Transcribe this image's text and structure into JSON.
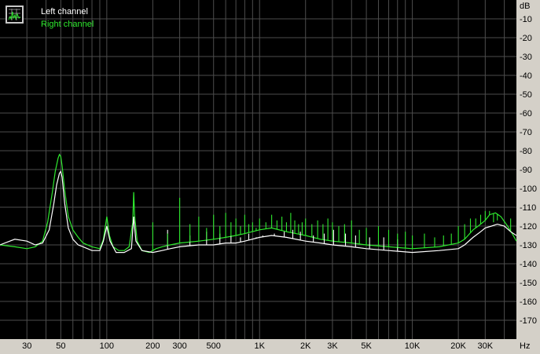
{
  "colors": {
    "plot_bg": "#000000",
    "grid": "#4d4d4d",
    "frame_bg": "#d4d0c8",
    "left_channel": "#ffffff",
    "right_channel": "#2ee82e"
  },
  "chart_data": {
    "type": "line",
    "x_scale": "log",
    "xlim": [
      20,
      48000
    ],
    "ylim": [
      -180,
      0
    ],
    "grid": true,
    "legend_position": "top-left",
    "legend_icon": "spectrum-icon",
    "y_unit": "dB",
    "x_unit": "Hz",
    "y_ticks": [
      "-10",
      "-20",
      "-30",
      "-40",
      "-50",
      "-60",
      "-70",
      "-80",
      "-90",
      "-100",
      "-110",
      "-120",
      "-130",
      "-140",
      "-150",
      "-160",
      "-170"
    ],
    "y_tick_values": [
      -10,
      -20,
      -30,
      -40,
      -50,
      -60,
      -70,
      -80,
      -90,
      -100,
      -110,
      -120,
      -130,
      -140,
      -150,
      -160,
      -170
    ],
    "x_ticks": [
      "30",
      "50",
      "100",
      "200",
      "300",
      "500",
      "1K",
      "2K",
      "3K",
      "5K",
      "10K",
      "20K",
      "30K"
    ],
    "x_tick_values": [
      30,
      50,
      100,
      200,
      300,
      500,
      1000,
      2000,
      3000,
      5000,
      10000,
      20000,
      30000
    ],
    "series": [
      {
        "name": "Left channel",
        "color": "#ffffff",
        "x": [
          20,
          25,
          30,
          34,
          38,
          42,
          45,
          47,
          49,
          50,
          51,
          53,
          56,
          60,
          65,
          70,
          80,
          90,
          95,
          100,
          105,
          115,
          130,
          145,
          150,
          155,
          170,
          200,
          230,
          260,
          300,
          400,
          500,
          600,
          700,
          800,
          1000,
          1200,
          1500,
          2000,
          2500,
          3000,
          4000,
          5000,
          7000,
          10000,
          15000,
          20000,
          22000,
          25000,
          28000,
          30000,
          33000,
          36000,
          40000,
          44000,
          48000
        ],
        "y": [
          -130,
          -127,
          -128,
          -130,
          -129,
          -122,
          -108,
          -98,
          -92,
          -91,
          -94,
          -108,
          -121,
          -127,
          -130,
          -131,
          -133,
          -133,
          -128,
          -120,
          -128,
          -134,
          -134,
          -132,
          -115,
          -128,
          -133,
          -134,
          -133,
          -132,
          -131,
          -130,
          -130,
          -129,
          -129,
          -128,
          -126,
          -125,
          -126,
          -128,
          -129,
          -130,
          -131,
          -132,
          -133,
          -134,
          -133,
          -132,
          -130,
          -126,
          -123,
          -121,
          -120,
          -119,
          -120,
          -123,
          -125
        ]
      },
      {
        "name": "Right channel",
        "color": "#2ee82e",
        "x": [
          20,
          25,
          30,
          34,
          38,
          41,
          44,
          46,
          48,
          49,
          50,
          51,
          53,
          56,
          60,
          65,
          70,
          80,
          90,
          95,
          100,
          104,
          110,
          120,
          130,
          140,
          148,
          150,
          152,
          158,
          170,
          190,
          200,
          210,
          230,
          260,
          300,
          400,
          500,
          600,
          700,
          800,
          1000,
          1200,
          1500,
          2000,
          2500,
          3000,
          4000,
          5000,
          7000,
          10000,
          15000,
          20000,
          22000,
          25000,
          27000,
          30000,
          32000,
          35000,
          38000,
          42000,
          45000,
          48000
        ],
        "y": [
          -130,
          -131,
          -132,
          -131,
          -128,
          -118,
          -102,
          -91,
          -84,
          -82,
          -83,
          -88,
          -101,
          -115,
          -122,
          -126,
          -129,
          -131,
          -132,
          -127,
          -115,
          -125,
          -131,
          -133,
          -133,
          -131,
          -118,
          -102,
          -114,
          -128,
          -133,
          -134,
          -133,
          -132,
          -131,
          -130,
          -129,
          -128,
          -127,
          -126,
          -125,
          -124,
          -122,
          -121,
          -123,
          -125,
          -127,
          -128,
          -129,
          -130,
          -131,
          -132,
          -131,
          -129,
          -127,
          -122,
          -120,
          -117,
          -114,
          -113,
          -115,
          -120,
          -124,
          -128
        ]
      }
    ],
    "harmonic_spikes": {
      "Left channel": {
        "x": [
          150,
          250,
          350,
          450,
          550,
          650,
          750,
          850,
          950,
          1050,
          1250,
          1450,
          1650,
          1850,
          2250,
          2650,
          3050,
          3650,
          4250,
          5250,
          6500,
          8000
        ],
        "y": [
          -116,
          -122,
          -125,
          -123,
          -124,
          -125,
          -126,
          -124,
          -126,
          -125,
          -124,
          -123,
          -122,
          -123,
          -125,
          -124,
          -122,
          -124,
          -125,
          -126,
          -126,
          -127
        ]
      },
      "Right channel": {
        "x": [
          200,
          250,
          300,
          350,
          400,
          450,
          500,
          550,
          600,
          650,
          700,
          750,
          800,
          850,
          900,
          950,
          1000,
          1100,
          1200,
          1300,
          1400,
          1500,
          1600,
          1700,
          1800,
          1900,
          2000,
          2200,
          2400,
          2600,
          2800,
          3000,
          3300,
          3600,
          4000,
          4500,
          5000,
          6000,
          7000,
          8000,
          9000,
          10000,
          12000,
          14000,
          16000,
          18000,
          20000,
          22000,
          24000,
          26000,
          28000,
          30000,
          32000,
          34000,
          36000,
          40000,
          44000
        ],
        "y": [
          -118,
          -124,
          -105,
          -119,
          -115,
          -121,
          -114,
          -120,
          -113,
          -118,
          -116,
          -120,
          -114,
          -119,
          -118,
          -121,
          -116,
          -118,
          -114,
          -117,
          -115,
          -118,
          -113,
          -117,
          -119,
          -118,
          -116,
          -119,
          -117,
          -119,
          -116,
          -118,
          -120,
          -119,
          -117,
          -122,
          -121,
          -120,
          -122,
          -124,
          -123,
          -125,
          -124,
          -126,
          -125,
          -124,
          -120,
          -119,
          -116,
          -116,
          -114,
          -112,
          -112,
          -118,
          -117,
          -118,
          -116
        ]
      }
    }
  }
}
